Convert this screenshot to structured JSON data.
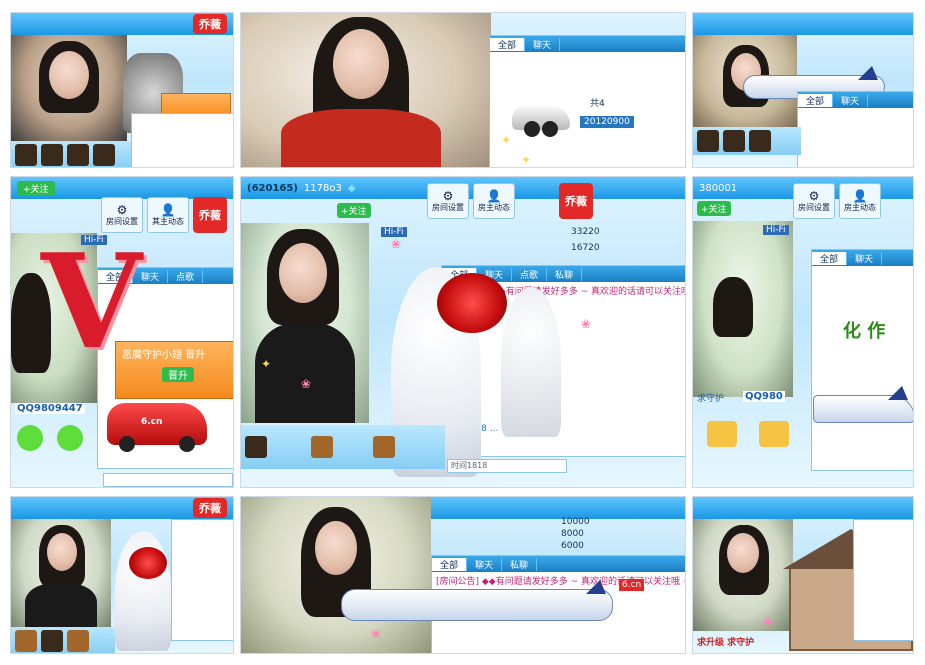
{
  "tiles": {
    "t1": {
      "id_text": "",
      "brand": "乔薇",
      "promo_text": "",
      "chat_tabs": []
    },
    "t2": {
      "id_text": "",
      "counter": "20120900",
      "label_1": "共4",
      "chat_tabs": [
        "全部",
        "聊天"
      ]
    },
    "t3": {
      "chat_tabs": [
        "全部",
        "聊天"
      ]
    },
    "t4": {
      "follow": "+关注",
      "room_buttons": [
        "房间设置",
        "其主动态"
      ],
      "brand": "乔薇",
      "chat_tabs": [
        "全部",
        "聊天",
        "点歌"
      ],
      "promo_title": "恶魔守护小翅 晋升",
      "promo_button": "晋升",
      "qq": "QQ9809447",
      "big_letter": "V",
      "hifi": "Hi-Fi",
      "car_label": "6.cn"
    },
    "t5": {
      "id_text": "(620165)",
      "follow": "+关注",
      "score": "1178o3",
      "room_buttons": [
        "房间设置",
        "房主动态"
      ],
      "brand": "乔薇",
      "chat_tabs": [
        "全部",
        "聊天",
        "点歌",
        "私聊"
      ],
      "values": [
        "33220",
        "16720"
      ],
      "hifi": "Hi-Fi",
      "chat_lines": [
        "[房间公告] ◆◆有问题请发好多多 ~ 真欢迎的话请可以关注哦 ~",
        "时间1818 ..."
      ],
      "input_text": "时间1818"
    },
    "t6": {
      "id_text": "380001",
      "room_buttons": [
        "房间设置",
        "房主动态"
      ],
      "follow": "+关注",
      "chat_tabs": [
        "全部",
        "聊天"
      ],
      "qq": "QQ980",
      "hifi": "Hi-Fi",
      "rank_text": "求守护",
      "banner": "化 作"
    },
    "t7": {
      "brand": "乔薇",
      "chat_tabs": []
    },
    "t8": {
      "chat_tabs": [
        "全部",
        "聊天",
        "私聊"
      ],
      "values": [
        "10000",
        "8000",
        "6000"
      ],
      "chat_lines": [
        "[房间公告] ◆◆有问题请发好多多 ~ 真欢迎的话请可以关注哦 ~"
      ],
      "plane_label": "6.cn"
    },
    "t9": {
      "bottom_text": "求升级 求守护",
      "chat_tabs": []
    }
  },
  "colors": {
    "accent": "#1b97e3",
    "brand_red": "#e32828",
    "chat_pink": "#c0237a",
    "follow_green": "#2dbb4e"
  }
}
